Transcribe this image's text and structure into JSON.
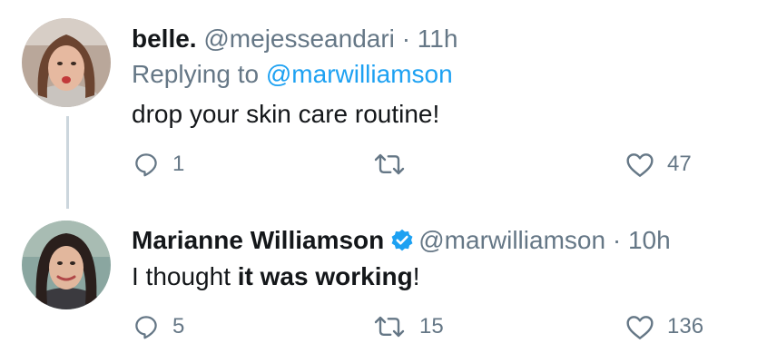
{
  "colors": {
    "accent": "#1da1f2",
    "muted": "#657786",
    "text": "#14171a",
    "thread_line": "#ccd6dd"
  },
  "tweets": [
    {
      "display_name": "belle.",
      "handle": "@mejesseandari",
      "separator": "·",
      "time": "11h",
      "replying_prefix": "Replying to",
      "replying_to": "@marwilliamson",
      "text": "drop your skin care routine!",
      "reply_count": "1",
      "retweet_count": "",
      "like_count": "47",
      "icons": [
        "reply-icon",
        "retweet-icon",
        "like-icon"
      ]
    },
    {
      "display_name": "Marianne Williamson",
      "verified": true,
      "handle": "@marwilliamson",
      "separator": "·",
      "time": "10h",
      "text_prefix": "I thought ",
      "text_bold": "it was working",
      "text_suffix": "!",
      "reply_count": "5",
      "retweet_count": "15",
      "like_count": "136",
      "icons": [
        "verified-badge-icon",
        "reply-icon",
        "retweet-icon",
        "like-icon"
      ]
    }
  ]
}
